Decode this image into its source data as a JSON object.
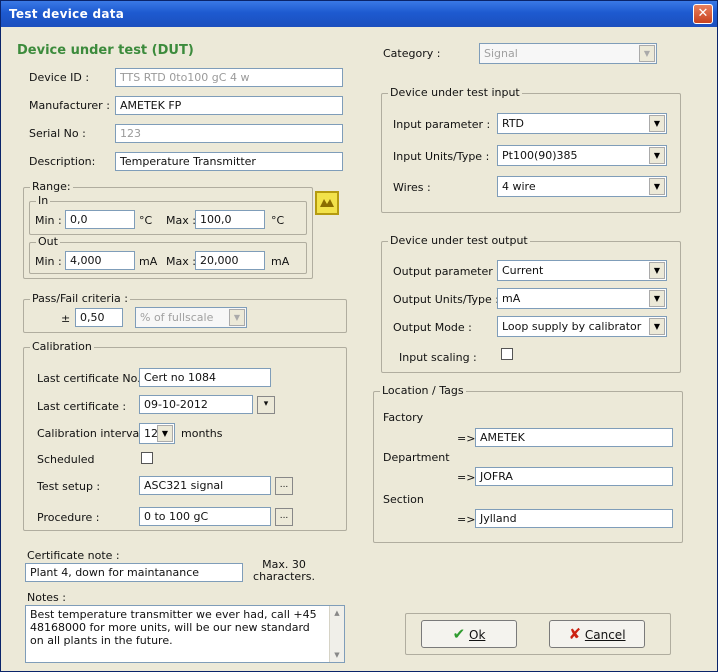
{
  "window": {
    "title": "Test device data",
    "close_symbol": "✕"
  },
  "dut": {
    "heading": "Device under test (DUT)",
    "device_id_label": "Device ID :",
    "device_id_value": "TTS RTD 0to100 gC 4 w",
    "manufacturer_label": "Manufacturer :",
    "manufacturer_value": "AMETEK FP",
    "serial_label": "Serial No :",
    "serial_value": "123",
    "description_label": "Description:",
    "description_value": "Temperature Transmitter"
  },
  "range": {
    "label": "Range:",
    "in_label": "In",
    "out_label": "Out",
    "in_min_label": "Min :",
    "in_min_value": "0,0",
    "in_min_unit": "°C",
    "in_max_label": "Max :",
    "in_max_value": "100,0",
    "in_max_unit": "°C",
    "out_min_label": "Min :",
    "out_min_value": "4,000",
    "out_min_unit": "mA",
    "out_max_label": "Max :",
    "out_max_value": "20,000",
    "out_max_unit": "mA"
  },
  "passfail": {
    "label": "Pass/Fail criteria :",
    "operator": "±",
    "value": "0,50",
    "mode": "% of fullscale"
  },
  "calibration": {
    "label": "Calibration",
    "last_cert_no_label": "Last certificate No. :",
    "last_cert_no_value": "Cert no 1084",
    "last_cert_label": "Last certificate :",
    "last_cert_value": "09-10-2012",
    "interval_label": "Calibration interval :",
    "interval_value": "12",
    "interval_unit": "months",
    "scheduled_label": "Scheduled",
    "test_setup_label": "Test setup :",
    "test_setup_value": "ASC321 signal",
    "procedure_label": "Procedure :",
    "procedure_value": "0 to 100 gC",
    "browse_symbol": "..."
  },
  "cert_note": {
    "label": "Certificate note :",
    "value": "Plant 4, down for maintanance",
    "hint": "Max. 30 characters."
  },
  "notes": {
    "label": "Notes :",
    "value": "Best temperature transmitter we ever had, call +45 48168000 for more units, will be our new standard on all plants in the future."
  },
  "category": {
    "label": "Category :",
    "value": "Signal"
  },
  "input": {
    "label": "Device under test input",
    "param_label": "Input parameter :",
    "param_value": "RTD",
    "units_label": "Input Units/Type :",
    "units_value": "Pt100(90)385",
    "wires_label": "Wires :",
    "wires_value": "4 wire"
  },
  "output": {
    "label": "Device under test output",
    "param_label": "Output parameter :",
    "param_value": "Current",
    "units_label": "Output Units/Type :",
    "units_value": "mA",
    "mode_label": "Output Mode :",
    "mode_value": "Loop supply by calibrator",
    "scaling_label": "Input scaling :"
  },
  "location": {
    "label": "Location / Tags",
    "factory_label": "Factory",
    "factory_value": "AMETEK",
    "department_label": "Department",
    "department_value": "JOFRA",
    "section_label": "Section",
    "section_value": "Jylland",
    "arrow": "=>"
  },
  "buttons": {
    "ok_label": "Ok",
    "ok_symbol": "✔",
    "ok_color": "#2e9b2e",
    "cancel_label": "Cancel",
    "cancel_symbol": "✘",
    "cancel_color": "#cc2211"
  }
}
